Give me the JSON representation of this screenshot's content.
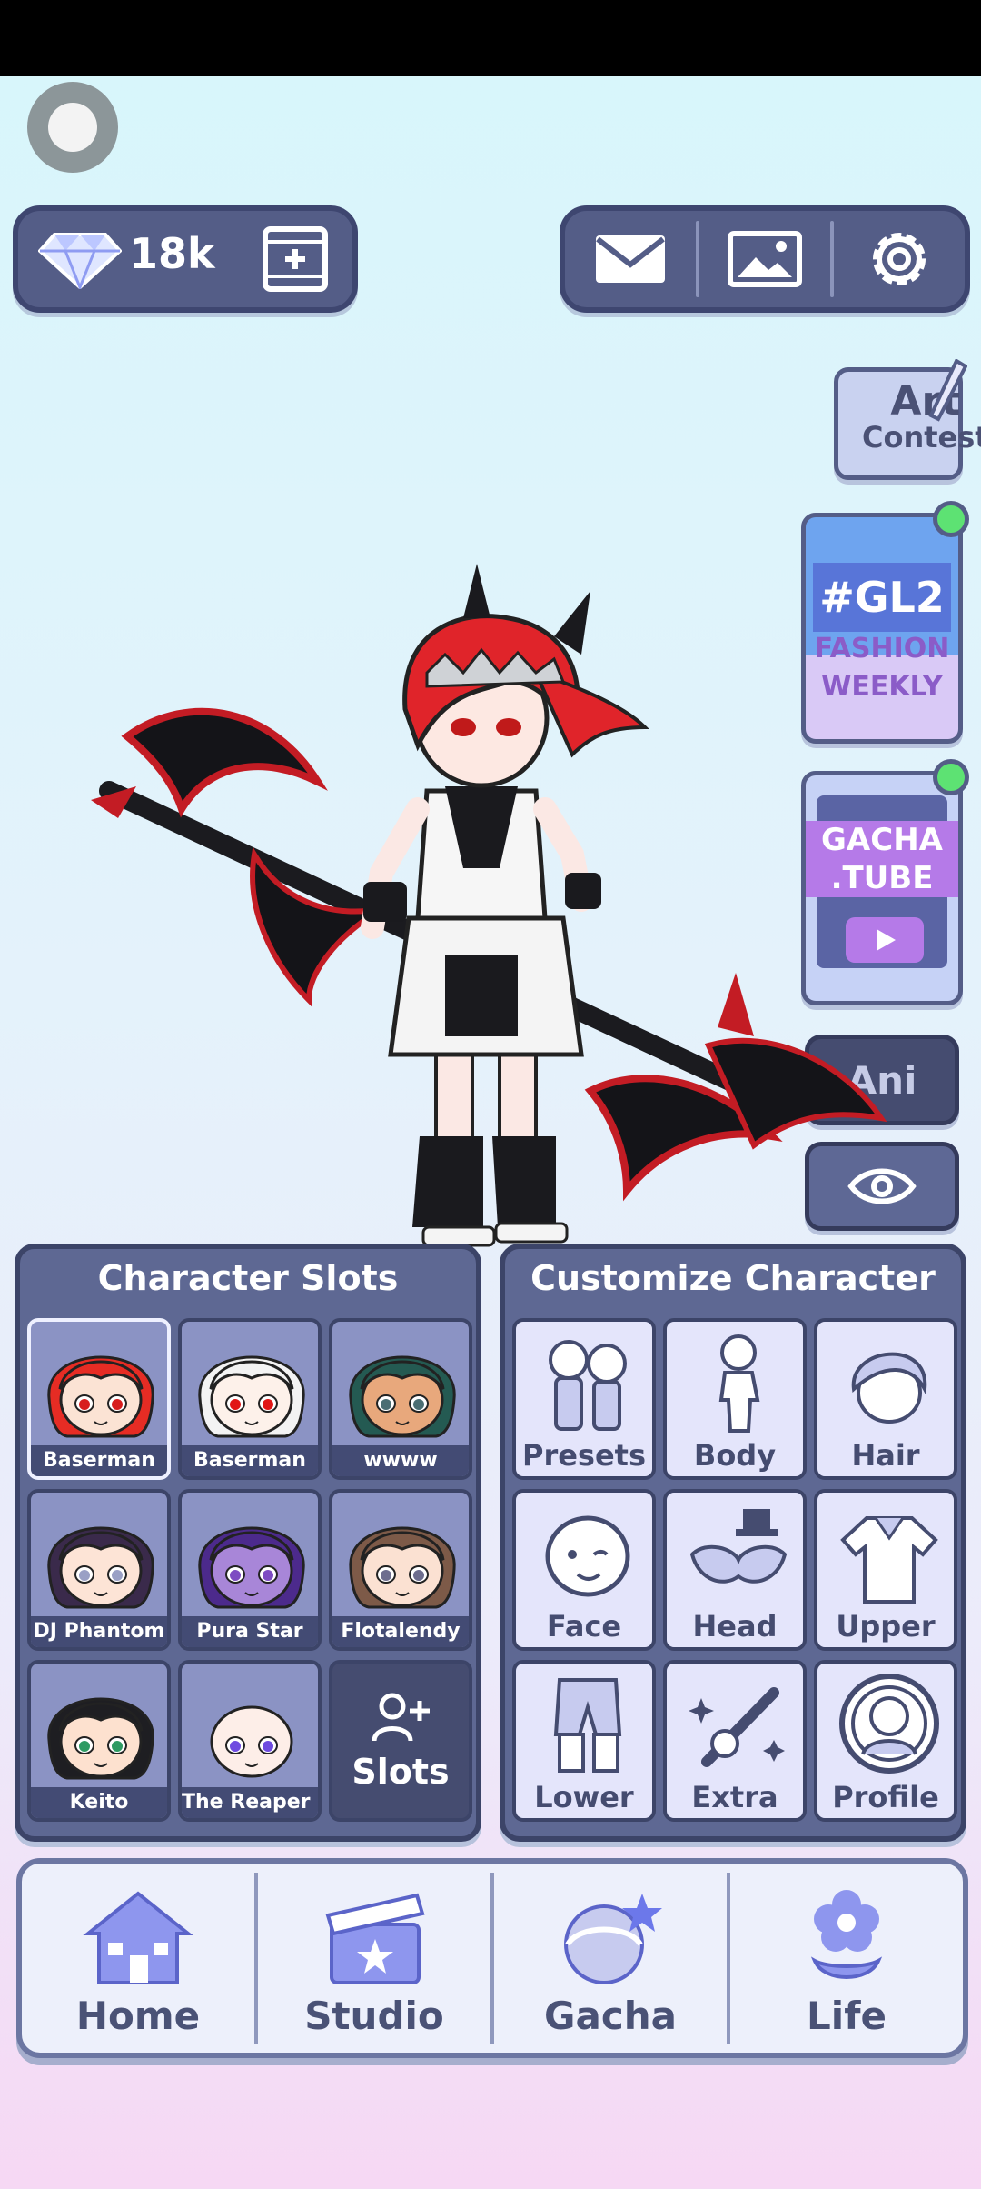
{
  "currency": {
    "gems": "18k"
  },
  "side": {
    "art_contest_1": "Art",
    "art_contest_2": "Contest",
    "gl2_title": "#GL2",
    "gl2_sub1": "FASHION",
    "gl2_sub2": "WEEKLY",
    "tube_1": "GACHA",
    "tube_2": ".TUBE",
    "ani": "Ani"
  },
  "slots": {
    "title": "Character Slots",
    "items": [
      {
        "name": "Baserman",
        "hair": "#e62c24",
        "eyes": "#d71d1d",
        "skin": "#fbe3d4"
      },
      {
        "name": "Baserman",
        "hair": "#f3f3f3",
        "eyes": "#e11616",
        "skin": "#fdf1ea"
      },
      {
        "name": "wwww",
        "hair": "#245a52",
        "eyes": "#4b6e73",
        "skin": "#e8a87c"
      },
      {
        "name": "DJ Phantom",
        "hair": "#3a2a4b",
        "eyes": "#9aa0c5",
        "skin": "#fde4d6"
      },
      {
        "name": "Pura Star",
        "hair": "#4c2a8c",
        "eyes": "#7d4bc2",
        "skin": "#a886d8"
      },
      {
        "name": "Flotalendy",
        "hair": "#7d5a48",
        "eyes": "#6d6d8e",
        "skin": "#fbe1d2"
      },
      {
        "name": "Keito",
        "hair": "#1e1e22",
        "eyes": "#2e9b63",
        "skin": "#fde1cf"
      },
      {
        "name": "The Reaper Bo",
        "hair": "none",
        "eyes": "#6e4be0",
        "skin": "#fdeee8"
      }
    ],
    "add_label": "Slots"
  },
  "customize": {
    "title": "Customize Character",
    "items": [
      "Presets",
      "Body",
      "Hair",
      "Face",
      "Head",
      "Upper",
      "Lower",
      "Extra",
      "Profile"
    ]
  },
  "nav": {
    "items": [
      "Home",
      "Studio",
      "Gacha",
      "Life"
    ]
  }
}
